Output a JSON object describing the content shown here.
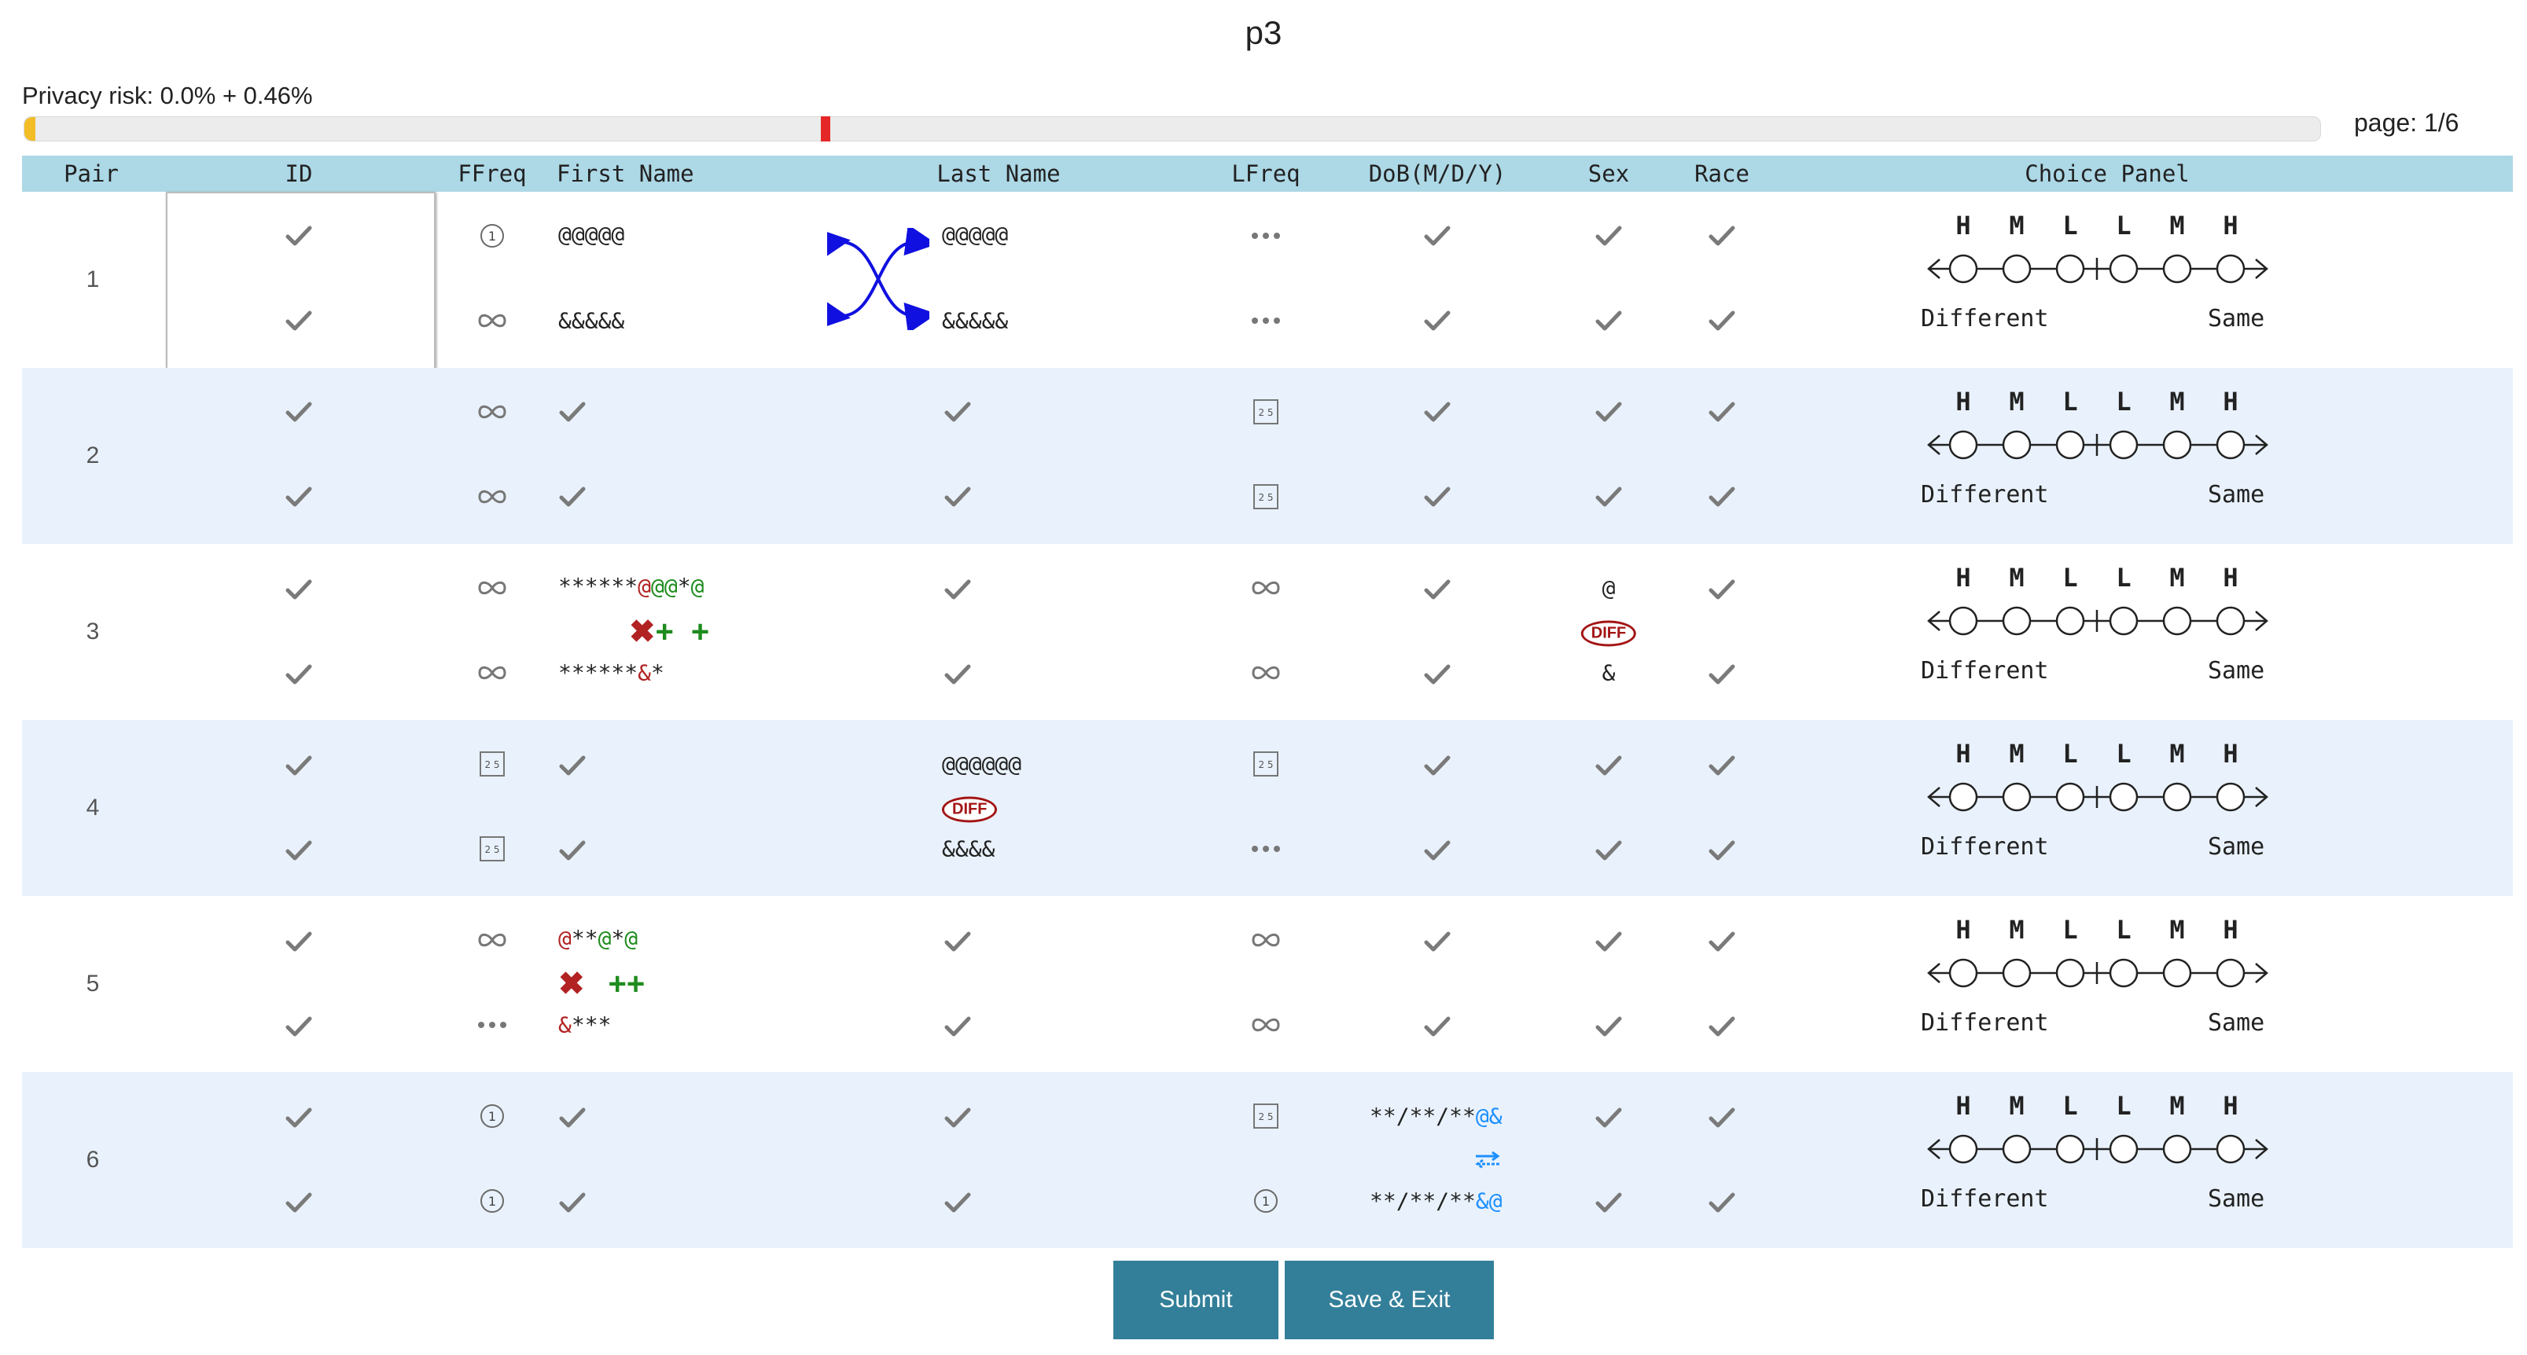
{
  "title": "p3",
  "privacy_risk": "Privacy risk: 0.0% + 0.46%",
  "privacy_progress": {
    "fill_fraction": 0.0046,
    "marker_fraction": 0.35
  },
  "page": "page: 1/6",
  "headers": {
    "pair": "Pair",
    "id": "ID",
    "ffreq": "FFreq",
    "first_name": "First Name",
    "last_name": "Last Name",
    "lfreq": "LFreq",
    "dob": "DoB(M/D/Y)",
    "sex": "Sex",
    "race": "Race",
    "choice_panel": "Choice Panel"
  },
  "choice_panel": {
    "letters": [
      "H",
      "M",
      "L",
      "L",
      "M",
      "H"
    ],
    "different": "Different",
    "same": "Same"
  },
  "rows": [
    {
      "pair": "1",
      "first_top": "@@@@@",
      "first_bottom": "&&&&&",
      "last_top": "@@@@@",
      "last_bottom": "&&&&&"
    },
    {
      "pair": "2"
    },
    {
      "pair": "3",
      "first_top_a": "******",
      "first_top_b": "@",
      "first_top_c": "@@",
      "first_top_d": "*",
      "first_top_e": "@",
      "first_bottom_a": "******",
      "first_bottom_b": "&",
      "first_bottom_c": "*",
      "first_marks_x": "✖",
      "first_marks_plus1": "+",
      "first_marks_plus2": "+",
      "sex_top": "@",
      "sex_diff": "DIFF",
      "sex_bottom": "&"
    },
    {
      "pair": "4",
      "last_top": "@@@@@@",
      "last_diff": "DIFF",
      "last_bottom": "&&&&"
    },
    {
      "pair": "5",
      "first_top_a": "@",
      "first_top_b": "**",
      "first_top_c": "@",
      "first_top_d": "*",
      "first_top_e": "@",
      "first_bottom_a": "&",
      "first_bottom_b": "***",
      "first_marks_x": "✖",
      "first_marks_plus": "++"
    },
    {
      "pair": "6",
      "dob_top_a": "**/**/**",
      "dob_top_b": "@&",
      "dob_bottom_a": "**/**/**",
      "dob_bottom_b": "&@"
    }
  ],
  "icons": {
    "check": "check-icon",
    "one": "circle-one-icon",
    "infinity": "infinity-icon",
    "ellipsis": "ellipsis-icon",
    "twentyfive": "box-25-icon",
    "swap": "swap-arrows-icon",
    "transpose": "transpose-icon"
  },
  "colors": {
    "header_bg": "#add8e6",
    "row_alt_bg": "#e9f2fc",
    "button_bg": "#337f99",
    "progress_fill": "#f2bd27",
    "progress_marker": "#e52727",
    "diff_red": "#b22222",
    "match_green": "#1e8c1e",
    "swap_blue": "#1e90ff",
    "arrow_blue": "#1010e0"
  },
  "buttons": {
    "submit": "Submit",
    "save_exit": "Save & Exit"
  }
}
